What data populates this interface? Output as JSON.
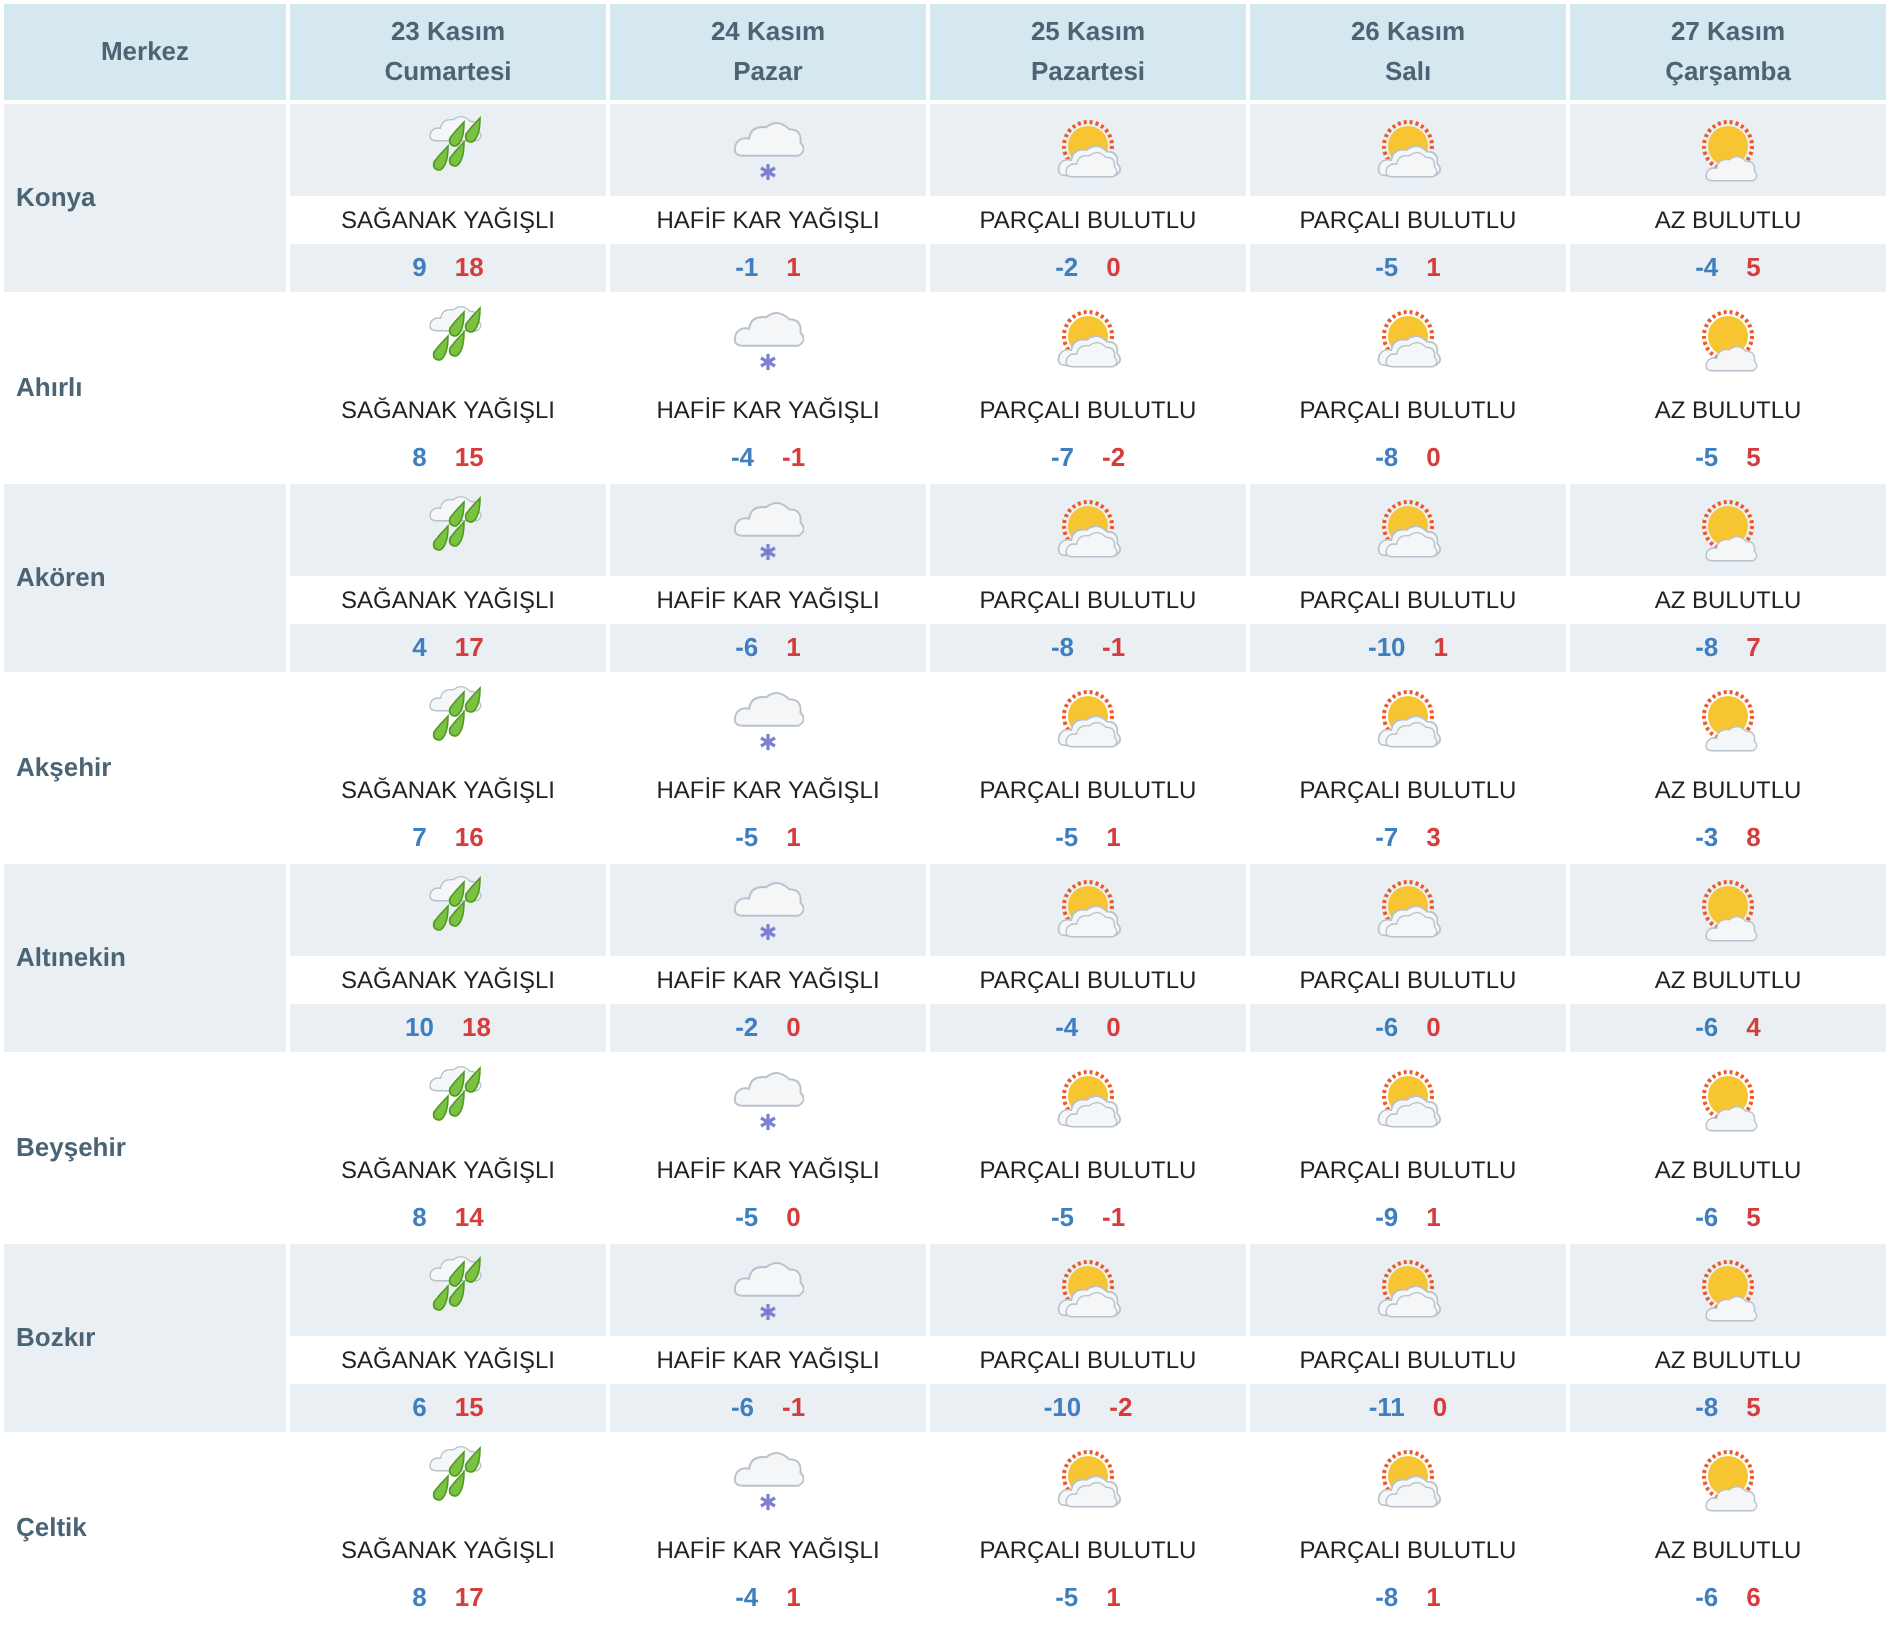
{
  "header": {
    "first": "Merkez",
    "days": [
      {
        "date": "23 Kasım",
        "weekday": "Cumartesi"
      },
      {
        "date": "24 Kasım",
        "weekday": "Pazar"
      },
      {
        "date": "25 Kasım",
        "weekday": "Pazartesi"
      },
      {
        "date": "26 Kasım",
        "weekday": "Salı"
      },
      {
        "date": "27 Kasım",
        "weekday": "Çarşamba"
      }
    ]
  },
  "rows": [
    {
      "name": "Konya",
      "days": [
        {
          "kind": "showers",
          "condition": "SAĞANAK YAĞIŞLI",
          "low": "9",
          "high": "18"
        },
        {
          "kind": "snow",
          "condition": "HAFİF KAR YAĞIŞLI",
          "low": "-1",
          "high": "1"
        },
        {
          "kind": "partly",
          "condition": "PARÇALI BULUTLU",
          "low": "-2",
          "high": "0"
        },
        {
          "kind": "partly",
          "condition": "PARÇALI BULUTLU",
          "low": "-5",
          "high": "1"
        },
        {
          "kind": "few",
          "condition": "AZ BULUTLU",
          "low": "-4",
          "high": "5"
        }
      ]
    },
    {
      "name": "Ahırlı",
      "days": [
        {
          "kind": "showers",
          "condition": "SAĞANAK YAĞIŞLI",
          "low": "8",
          "high": "15"
        },
        {
          "kind": "snow",
          "condition": "HAFİF KAR YAĞIŞLI",
          "low": "-4",
          "high": "-1"
        },
        {
          "kind": "partly",
          "condition": "PARÇALI BULUTLU",
          "low": "-7",
          "high": "-2"
        },
        {
          "kind": "partly",
          "condition": "PARÇALI BULUTLU",
          "low": "-8",
          "high": "0"
        },
        {
          "kind": "few",
          "condition": "AZ BULUTLU",
          "low": "-5",
          "high": "5"
        }
      ]
    },
    {
      "name": "Akören",
      "days": [
        {
          "kind": "showers",
          "condition": "SAĞANAK YAĞIŞLI",
          "low": "4",
          "high": "17"
        },
        {
          "kind": "snow",
          "condition": "HAFİF KAR YAĞIŞLI",
          "low": "-6",
          "high": "1"
        },
        {
          "kind": "partly",
          "condition": "PARÇALI BULUTLU",
          "low": "-8",
          "high": "-1"
        },
        {
          "kind": "partly",
          "condition": "PARÇALI BULUTLU",
          "low": "-10",
          "high": "1"
        },
        {
          "kind": "few",
          "condition": "AZ BULUTLU",
          "low": "-8",
          "high": "7"
        }
      ]
    },
    {
      "name": "Akşehir",
      "days": [
        {
          "kind": "showers",
          "condition": "SAĞANAK YAĞIŞLI",
          "low": "7",
          "high": "16"
        },
        {
          "kind": "snow",
          "condition": "HAFİF KAR YAĞIŞLI",
          "low": "-5",
          "high": "1"
        },
        {
          "kind": "partly",
          "condition": "PARÇALI BULUTLU",
          "low": "-5",
          "high": "1"
        },
        {
          "kind": "partly",
          "condition": "PARÇALI BULUTLU",
          "low": "-7",
          "high": "3"
        },
        {
          "kind": "few",
          "condition": "AZ BULUTLU",
          "low": "-3",
          "high": "8"
        }
      ]
    },
    {
      "name": "Altınekin",
      "days": [
        {
          "kind": "showers",
          "condition": "SAĞANAK YAĞIŞLI",
          "low": "10",
          "high": "18"
        },
        {
          "kind": "snow",
          "condition": "HAFİF KAR YAĞIŞLI",
          "low": "-2",
          "high": "0"
        },
        {
          "kind": "partly",
          "condition": "PARÇALI BULUTLU",
          "low": "-4",
          "high": "0"
        },
        {
          "kind": "partly",
          "condition": "PARÇALI BULUTLU",
          "low": "-6",
          "high": "0"
        },
        {
          "kind": "few",
          "condition": "AZ BULUTLU",
          "low": "-6",
          "high": "4"
        }
      ]
    },
    {
      "name": "Beyşehir",
      "days": [
        {
          "kind": "showers",
          "condition": "SAĞANAK YAĞIŞLI",
          "low": "8",
          "high": "14"
        },
        {
          "kind": "snow",
          "condition": "HAFİF KAR YAĞIŞLI",
          "low": "-5",
          "high": "0"
        },
        {
          "kind": "partly",
          "condition": "PARÇALI BULUTLU",
          "low": "-5",
          "high": "-1"
        },
        {
          "kind": "partly",
          "condition": "PARÇALI BULUTLU",
          "low": "-9",
          "high": "1"
        },
        {
          "kind": "few",
          "condition": "AZ BULUTLU",
          "low": "-6",
          "high": "5"
        }
      ]
    },
    {
      "name": "Bozkır",
      "days": [
        {
          "kind": "showers",
          "condition": "SAĞANAK YAĞIŞLI",
          "low": "6",
          "high": "15"
        },
        {
          "kind": "snow",
          "condition": "HAFİF KAR YAĞIŞLI",
          "low": "-6",
          "high": "-1"
        },
        {
          "kind": "partly",
          "condition": "PARÇALI BULUTLU",
          "low": "-10",
          "high": "-2"
        },
        {
          "kind": "partly",
          "condition": "PARÇALI BULUTLU",
          "low": "-11",
          "high": "0"
        },
        {
          "kind": "few",
          "condition": "AZ BULUTLU",
          "low": "-8",
          "high": "5"
        }
      ]
    },
    {
      "name": "Çeltik",
      "days": [
        {
          "kind": "showers",
          "condition": "SAĞANAK YAĞIŞLI",
          "low": "8",
          "high": "17"
        },
        {
          "kind": "snow",
          "condition": "HAFİF KAR YAĞIŞLI",
          "low": "-4",
          "high": "1"
        },
        {
          "kind": "partly",
          "condition": "PARÇALI BULUTLU",
          "low": "-5",
          "high": "1"
        },
        {
          "kind": "partly",
          "condition": "PARÇALI BULUTLU",
          "low": "-8",
          "high": "1"
        },
        {
          "kind": "few",
          "condition": "AZ BULUTLU",
          "low": "-6",
          "high": "6"
        }
      ]
    }
  ]
}
